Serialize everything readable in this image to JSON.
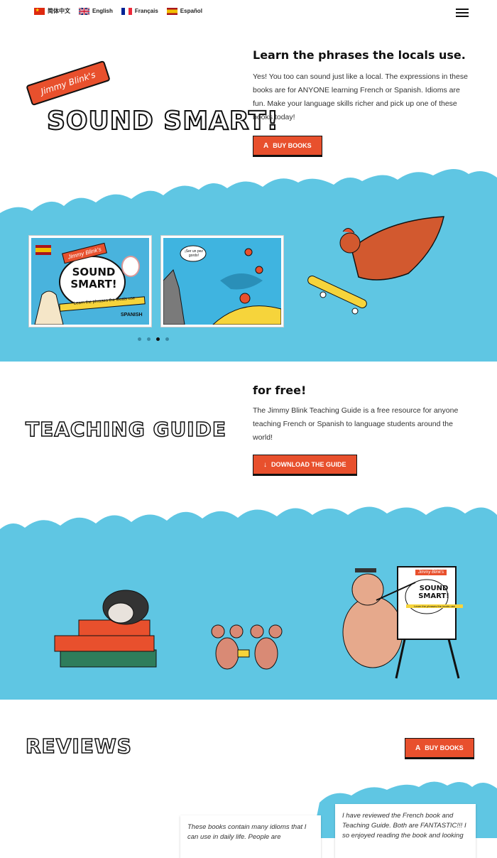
{
  "languages": [
    {
      "label": "简体中文",
      "flag": "china-flag-icon"
    },
    {
      "label": "English",
      "flag": "uk-flag-icon"
    },
    {
      "label": "Français",
      "flag": "france-flag-icon"
    },
    {
      "label": "Español",
      "flag": "spain-flag-icon"
    }
  ],
  "hero": {
    "ribbon": "Jimmy Blink's",
    "title": "SOUND SMART!",
    "subheading": "Learn the phrases the locals use.",
    "body": "Yes! You too can sound just like a local. The expressions in these books are for ANYONE learning French or Spanish. Idioms are fun. Make your language skills richer and pick up one of these books today!",
    "button": "BUY BOOKS"
  },
  "carousel": {
    "card1": {
      "ribbon": "Jimmy Blink's",
      "title": "SOUND SMART!",
      "tagline": "Learn the phrases the locals use",
      "language": "SPANISH"
    },
    "card2": {
      "bubble": "¡Ser un pez gordo!"
    },
    "dots": 4,
    "active_dot": 2
  },
  "teaching": {
    "title": "TEACHING GUIDE",
    "subheading": "for free!",
    "body": "The Jimmy Blink Teaching Guide is a free resource for anyone teaching French or Spanish to language students around the world!",
    "button": "DOWNLOAD THE GUIDE",
    "easel_ribbon": "Jimmy Blink's",
    "easel_title": "SOUND SMART!",
    "easel_tagline": "Learn the phrases the locals use"
  },
  "reviews": {
    "title": "REVIEWS",
    "button": "BUY BOOKS",
    "items": [
      {
        "text": "These books contain many idioms that I can use in daily life. People are"
      },
      {
        "text": "I have reviewed the French book and Teaching Guide. Both are FANTASTIC!!! I so enjoyed reading the book and looking"
      }
    ]
  },
  "colors": {
    "accent": "#e8502d",
    "sky": "#5fc6e3"
  }
}
